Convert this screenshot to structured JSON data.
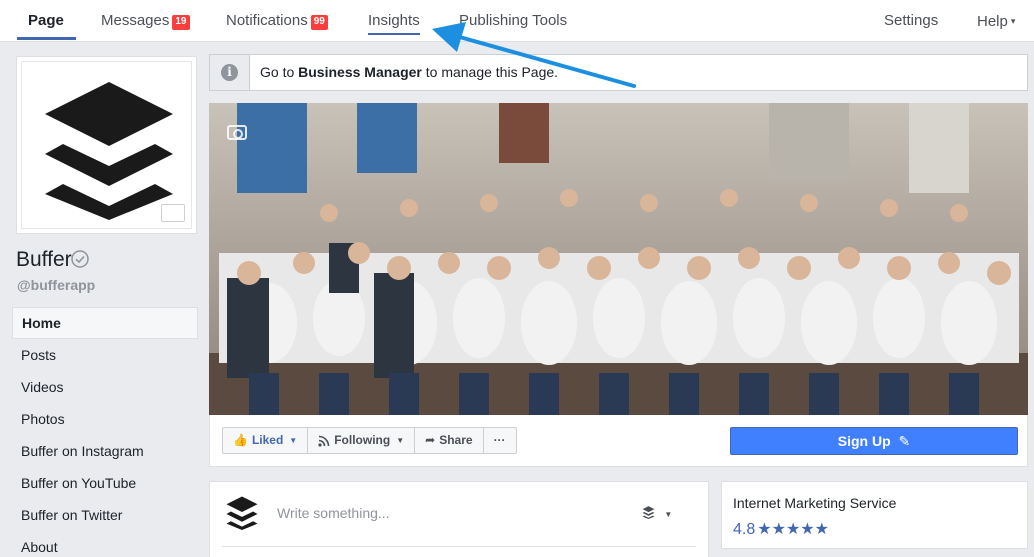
{
  "colors": {
    "brand_blue": "#4267b2",
    "signup_blue": "#4080ff",
    "badge_red": "#fa3e3e",
    "annotation_arrow": "#1d8fe1"
  },
  "topnav": {
    "page": "Page",
    "messages": "Messages",
    "messages_count": "19",
    "notifications": "Notifications",
    "notifications_count": "99",
    "insights": "Insights",
    "publishing_tools": "Publishing Tools",
    "settings": "Settings",
    "help": "Help",
    "help_caret": "▾"
  },
  "notice": {
    "icon": "info-icon",
    "prefix": "Go to ",
    "link": "Business Manager",
    "suffix": " to manage this Page."
  },
  "profile": {
    "name": "Buffer",
    "handle": "@bufferapp",
    "verified_icon": "verified-check-icon"
  },
  "sidebar": {
    "items": [
      {
        "label": "Home",
        "active": true
      },
      {
        "label": "Posts"
      },
      {
        "label": "Videos"
      },
      {
        "label": "Photos"
      },
      {
        "label": "Buffer on Instagram"
      },
      {
        "label": "Buffer on YouTube"
      },
      {
        "label": "Buffer on Twitter"
      },
      {
        "label": "About"
      }
    ]
  },
  "actions": {
    "liked": "Liked",
    "following": "Following",
    "share": "Share",
    "more": "···",
    "signup": "Sign Up",
    "signup_icon": "pencil-icon"
  },
  "composer": {
    "placeholder": "Write something...",
    "switcher_icon": "buffer-layers-icon"
  },
  "about": {
    "category": "Internet Marketing Service",
    "rating": "4.8",
    "stars": "★★★★★"
  }
}
